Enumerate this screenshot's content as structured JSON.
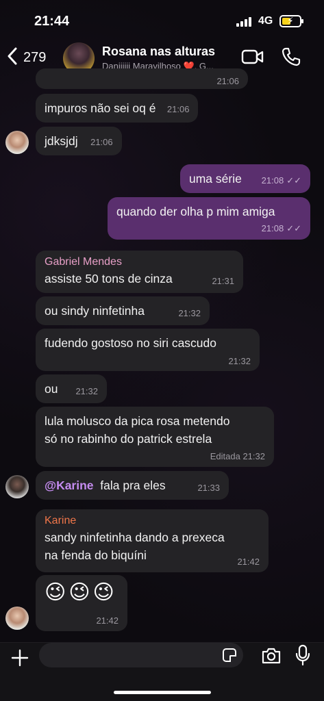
{
  "status_bar": {
    "time": "21:44",
    "network": "4G"
  },
  "header": {
    "back_count": "279",
    "title": "Rosana nas alturas",
    "subtitle": "Daniiiiii Maravilhoso ❤️, G..."
  },
  "messages": [
    {
      "id": "m0",
      "time": "21:06"
    },
    {
      "id": "m1",
      "text": "impuros não sei oq é",
      "time": "21:06"
    },
    {
      "id": "m2",
      "text": "jdksjdj",
      "time": "21:06"
    },
    {
      "id": "m3",
      "text": "uma série",
      "time": "21:08",
      "checks": "✓✓"
    },
    {
      "id": "m4",
      "text": "quando der olha p mim amiga",
      "time": "21:08",
      "checks": "✓✓"
    },
    {
      "id": "m5",
      "sender": "Gabriel Mendes",
      "sender_color": "#e8a0c8",
      "text": "assiste 50 tons de cinza",
      "time": "21:31"
    },
    {
      "id": "m6",
      "text": "ou sindy ninfetinha",
      "time": "21:32"
    },
    {
      "id": "m7",
      "text": "fudendo gostoso no siri cascudo",
      "time": "21:32"
    },
    {
      "id": "m8",
      "text": "ou",
      "time": "21:32"
    },
    {
      "id": "m9",
      "text_line1": "lula molusco da pica rosa metendo",
      "text_line2": "só no rabinho do patrick estrela",
      "edited": "Editada",
      "time": "21:32"
    },
    {
      "id": "m10",
      "mention": "@Karine",
      "text": "fala pra eles",
      "time": "21:33"
    },
    {
      "id": "m11",
      "sender": "Karine",
      "sender_color": "#f0764a",
      "text_line1": "sandy ninfetinha dando a prexeca",
      "text_line2": "na fenda do biquíni",
      "time": "21:42"
    },
    {
      "id": "m12",
      "emojis": "😉😉😉",
      "time": "21:42"
    }
  ],
  "composer": {
    "placeholder": ""
  },
  "icons": {
    "back": "chevron-left-icon",
    "video": "video-call-icon",
    "phone": "phone-icon",
    "attach": "plus-icon",
    "sticker": "sticker-icon",
    "camera": "camera-icon",
    "mic": "microphone-icon"
  }
}
